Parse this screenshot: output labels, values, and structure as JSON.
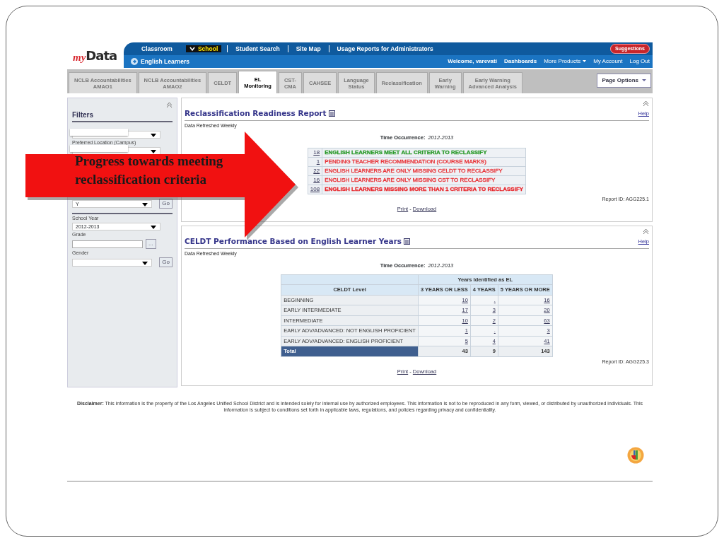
{
  "header": {
    "logo_prefix": "my",
    "logo_text": "Data",
    "nav_links": [
      {
        "label": "Classroom",
        "selected": false
      },
      {
        "label": "School",
        "selected": true
      },
      {
        "label": "Student Search",
        "selected": false
      },
      {
        "label": "Site Map",
        "selected": false
      },
      {
        "label": "Usage Reports for Administrators",
        "selected": false
      }
    ],
    "suggestions": "Suggestions",
    "section": "English Learners",
    "welcome": "Welcome, varevati",
    "user_links": [
      {
        "label": "Dashboards",
        "dropdown": false
      },
      {
        "label": "More Products",
        "dropdown": true
      },
      {
        "label": "My Account",
        "dropdown": false
      },
      {
        "label": "Log Out",
        "dropdown": false
      }
    ]
  },
  "tabs": [
    {
      "lines": [
        "NCLB Accountabilities",
        "AMAO1"
      ],
      "selected": false
    },
    {
      "lines": [
        "NCLB Accountabilities",
        "AMAO2"
      ],
      "selected": false
    },
    {
      "lines": [
        "CELDT"
      ],
      "selected": false
    },
    {
      "lines": [
        "EL",
        "Monitoring"
      ],
      "selected": true
    },
    {
      "lines": [
        "CST-",
        "CMA"
      ],
      "selected": false
    },
    {
      "lines": [
        "CAHSEE"
      ],
      "selected": false
    },
    {
      "lines": [
        "Language",
        "Status"
      ],
      "selected": false
    },
    {
      "lines": [
        "Reclassification"
      ],
      "selected": false
    },
    {
      "lines": [
        "Early",
        "Warning"
      ],
      "selected": false
    },
    {
      "lines": [
        "Early Warning",
        "Advanced Analysis"
      ],
      "selected": false
    }
  ],
  "page_options": "Page Options",
  "filters": {
    "title": "Filters",
    "groups": [
      [
        {
          "kind": "select",
          "redacted": true
        },
        {
          "kind": "select",
          "label": "Preferred Location (Campus)",
          "redacted": true
        },
        {
          "kind": "select",
          "value": "Y",
          "go": "Go"
        }
      ],
      [
        {
          "kind": "select",
          "label": "School Year",
          "value": "2012-2013"
        },
        {
          "kind": "lookup",
          "label": "Grade",
          "button": "..."
        },
        {
          "kind": "select",
          "label": "Gender",
          "go": "Go"
        }
      ]
    ]
  },
  "reports": [
    {
      "kind": "list",
      "title": "Reclassification Readiness Report",
      "help": "Help",
      "refresh": "Data Refreshed Weekly",
      "time_label": "Time Occurrence:",
      "time_value": "2012-2013",
      "items": [
        {
          "count": "18",
          "text": "ENGLISH LEARNERS MEET ALL CRITERIA TO RECLASSIFY",
          "color": "#2a9a2a",
          "bold": true
        },
        {
          "count": "1",
          "text": "PENDING TEACHER RECOMMENDATION (COURSE MARKS)",
          "color": "#e8262b",
          "bold": false
        },
        {
          "count": "22",
          "text": "ENGLISH LEARNERS ARE ONLY MISSING CELDT TO RECLASSIFY",
          "color": "#e8262b",
          "bold": false
        },
        {
          "count": "16",
          "text": "ENGLISH LEARNERS ARE ONLY MISSING CST TO RECLASSIFY",
          "color": "#e8262b",
          "bold": false
        },
        {
          "count": "108",
          "text": "ENGLISH LEARNERS MISSING MORE THAN 1 CRITERIA TO RECLASSIFY",
          "color": "#e8262b",
          "bold": true
        }
      ],
      "report_id": "Report ID: AGG225.1",
      "print": "Print",
      "separator": "-",
      "download": "Download"
    },
    {
      "kind": "table",
      "title": "CELDT Performance Based on English Learner Years",
      "help": "Help",
      "refresh": "Data Refreshed Weekly",
      "time_label": "Time Occurrence:",
      "time_value": "2012-2013",
      "table": {
        "group_header": "Years Identified as EL",
        "columns": [
          "CELDT Level",
          "3 YEARS OR LESS",
          "4 YEARS",
          "5 YEARS OR MORE"
        ],
        "rows": [
          {
            "kind": "data",
            "cells": [
              "BEGINNING",
              "10",
              ".",
              "16"
            ]
          },
          {
            "kind": "data",
            "cells": [
              "EARLY INTERMEDIATE",
              "17",
              "3",
              "20"
            ]
          },
          {
            "kind": "data",
            "cells": [
              "INTERMEDIATE",
              "10",
              "2",
              "63"
            ]
          },
          {
            "kind": "data",
            "cells": [
              "EARLY ADV/ADVANCED: NOT ENGLISH PROFICIENT",
              "1",
              ".",
              "3"
            ]
          },
          {
            "kind": "data",
            "cells": [
              "EARLY ADV/ADVANCED: ENGLISH PROFICIENT",
              "5",
              "4",
              "41"
            ]
          },
          {
            "kind": "total",
            "cells": [
              "Total",
              "43",
              "9",
              "143"
            ]
          }
        ]
      },
      "report_id": "Report ID: AGG225.3",
      "print": "Print",
      "separator": "-",
      "download": "Download"
    }
  ],
  "disclaimer": "**Disclaimer:** This information is the property of the Los Angeles Unified School District and is intended solely for internal use by authorized employees. This information is not to be reproduced in any form, viewed, or distributed by unauthorized individuals. This information is subject to conditions set forth in applicable laws, regulations, and policies regarding privacy and confidentiality.",
  "callout": {
    "lines": [
      "Progress towards meeting",
      "reclassification criteria"
    ]
  }
}
